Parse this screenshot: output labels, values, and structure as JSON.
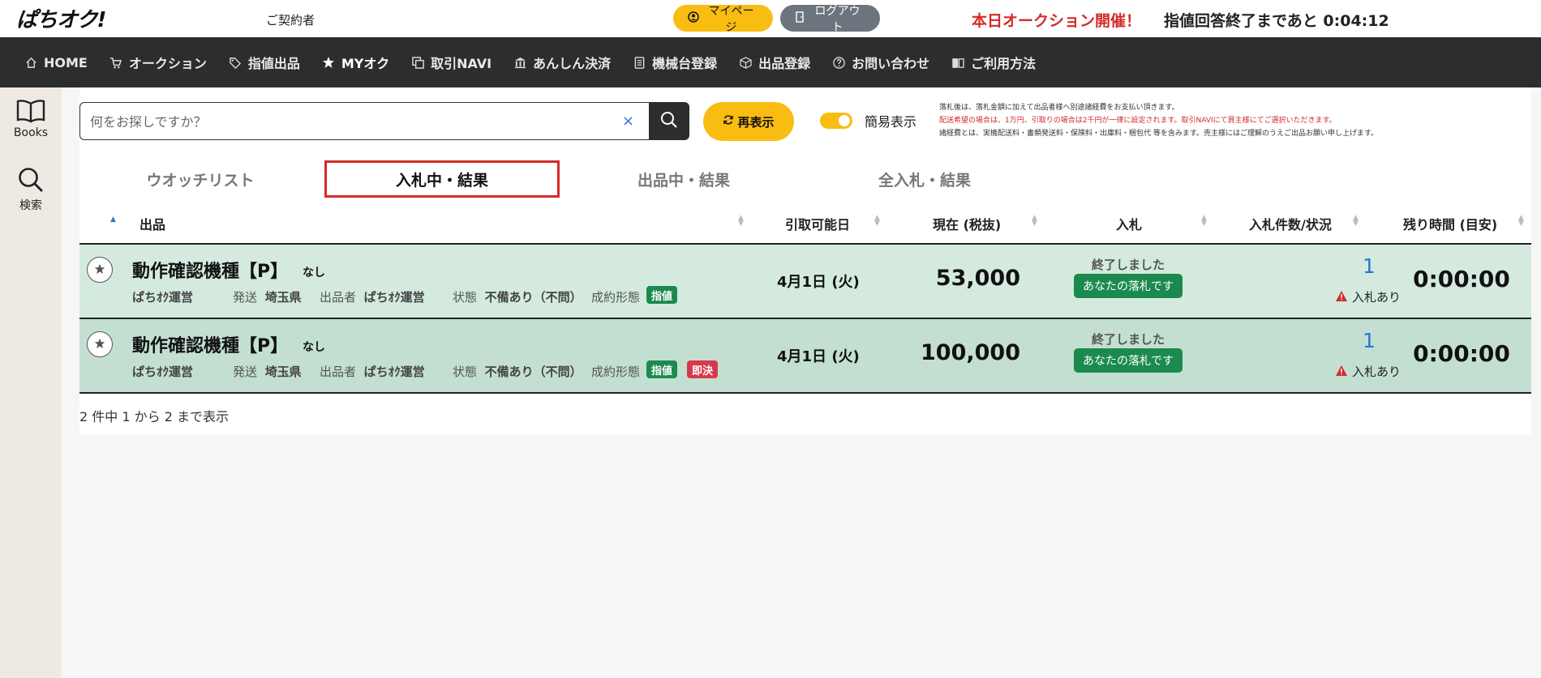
{
  "header": {
    "logo": "ぱちオク!",
    "contractor": "ご契約者",
    "mypage_label": "マイページ",
    "logout_label": "ログアウト",
    "notice": "本日オークション開催！",
    "countdown": "指値回答終了まであと 0:04:12"
  },
  "nav": [
    {
      "label": "HOME",
      "icon": "home-icon"
    },
    {
      "label": "オークション",
      "icon": "cart-icon"
    },
    {
      "label": "指値出品",
      "icon": "tag-icon"
    },
    {
      "label": "MYオク",
      "icon": "star-icon"
    },
    {
      "label": "取引NAVI",
      "icon": "copy-icon"
    },
    {
      "label": "あんしん決済",
      "icon": "bank-icon"
    },
    {
      "label": "機械台登録",
      "icon": "machine-icon"
    },
    {
      "label": "出品登録",
      "icon": "box-icon"
    },
    {
      "label": "お問い合わせ",
      "icon": "question-icon"
    },
    {
      "label": "ご利用方法",
      "icon": "book-icon"
    }
  ],
  "rail": {
    "books_label": "Books",
    "search_label": "検索"
  },
  "search": {
    "placeholder": "何をお探しですか？",
    "clear": "×",
    "refresh_label": "再表示",
    "simple_label": "簡易表示",
    "simple_on": true
  },
  "fine_print": [
    "落札後は、落札金額に加えて出品者様へ別途諸経費をお支払い頂きます。",
    "配送希望の場合は、1万円、引取りの場合は2千円が一律に設定されます。取引NAVIにて買主様にてご選択いただきます。",
    "諸経費とは、実機配送料・書類発送料・保険料・出庫料・梱包代 等を含みます。売主様にはご理解のうえご出品お願い申し上げます。"
  ],
  "tabs": [
    {
      "label": "ウオッチリスト",
      "active": false
    },
    {
      "label": "入札中・結果",
      "active": true
    },
    {
      "label": "出品中・結果",
      "active": false
    },
    {
      "label": "全入札・結果",
      "active": false
    }
  ],
  "table": {
    "sort_up": "▲",
    "columns": [
      "出品",
      "引取可能日",
      "現在 (税抜)",
      "入札",
      "入札件数/状況",
      "残り時間 (目安)"
    ],
    "meta_labels": {
      "ship": "発送",
      "seller": "出品者",
      "condition": "状態",
      "deal": "成約形態"
    },
    "rows": [
      {
        "title": "動作確認機種【P】",
        "sub": "なし",
        "operator": "ぱちｵｸ運営",
        "ship": "埼玉県",
        "seller": "ぱちｵｸ運営",
        "condition": "不備あり（不問）",
        "badges": [
          "指値"
        ],
        "date": "4月1日 (火)",
        "price": "53,000",
        "status": "終了しました",
        "result": "あなたの落札です",
        "bid_count": "1",
        "bid_state": "入札あり",
        "remain": "0:00:00"
      },
      {
        "title": "動作確認機種【P】",
        "sub": "なし",
        "operator": "ぱちｵｸ運営",
        "ship": "埼玉県",
        "seller": "ぱちｵｸ運営",
        "condition": "不備あり（不問）",
        "badges": [
          "指値",
          "即決"
        ],
        "date": "4月1日 (火)",
        "price": "100,000",
        "status": "終了しました",
        "result": "あなたの落札です",
        "bid_count": "1",
        "bid_state": "入札あり",
        "remain": "0:00:00"
      }
    ]
  },
  "pagination_info": "2 件中 1 から 2 まで表示",
  "colors": {
    "accent_yellow": "#f9bd12",
    "nav_bg": "#2b2d2f",
    "alert_red": "#d42a2a",
    "success_green": "#1c8a4e",
    "row1_bg": "#d4eadf",
    "row2_bg": "#c3dfd1"
  }
}
